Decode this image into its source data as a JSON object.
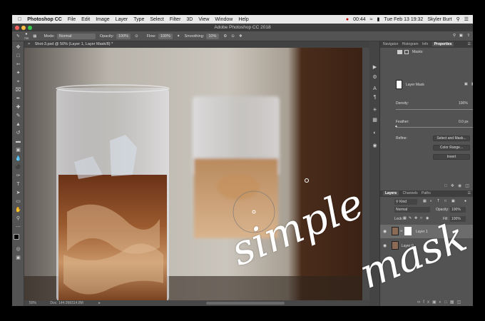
{
  "mac_menu": {
    "app": "Photoshop CC",
    "items": [
      "File",
      "Edit",
      "Image",
      "Layer",
      "Type",
      "Select",
      "Filter",
      "3D",
      "View",
      "Window",
      "Help"
    ],
    "time": "00:44",
    "datetime": "Tue Feb 13  19:32",
    "user": "Skyler Burt"
  },
  "window_title": "Adobe Photoshop CC 2018",
  "options_bar": {
    "mode_label": "Mode:",
    "mode_value": "Normal",
    "opacity_label": "Opacity:",
    "opacity_value": "100%",
    "flow_label": "Flow:",
    "flow_value": "100%",
    "smoothing_label": "Smoothing:",
    "smoothing_value": "10%",
    "brush_size": "700"
  },
  "doc_tab": "Shot-3.psd @ 50% (Layer 1, Layer Mask/8) *",
  "status": {
    "zoom": "50%",
    "doc": "Doc: 144.0M/314.8M"
  },
  "panels": {
    "top_tabs": [
      "Navigator",
      "Histogram",
      "Info",
      "Properties"
    ],
    "properties_title": "Masks",
    "layer_mask_label": "Layer Mask",
    "density_label": "Density:",
    "density_value": "100%",
    "feather_label": "Feather:",
    "feather_value": "0.0 px",
    "refine_label": "Refine:",
    "btn_select_mask": "Select and Mask...",
    "btn_color_range": "Color Range...",
    "btn_invert": "Invert",
    "layers_tabs": [
      "Layers",
      "Channels",
      "Paths"
    ],
    "kind": "Kind",
    "blend_mode": "Normal",
    "opacity_label": "Opacity:",
    "opacity_value": "100%",
    "lock_label": "Lock:",
    "fill_label": "Fill:",
    "fill_value": "100%",
    "layers": [
      "Layer 1",
      "Layer 0"
    ]
  },
  "overlay_text": {
    "word1": "simple",
    "word2": "mask"
  }
}
